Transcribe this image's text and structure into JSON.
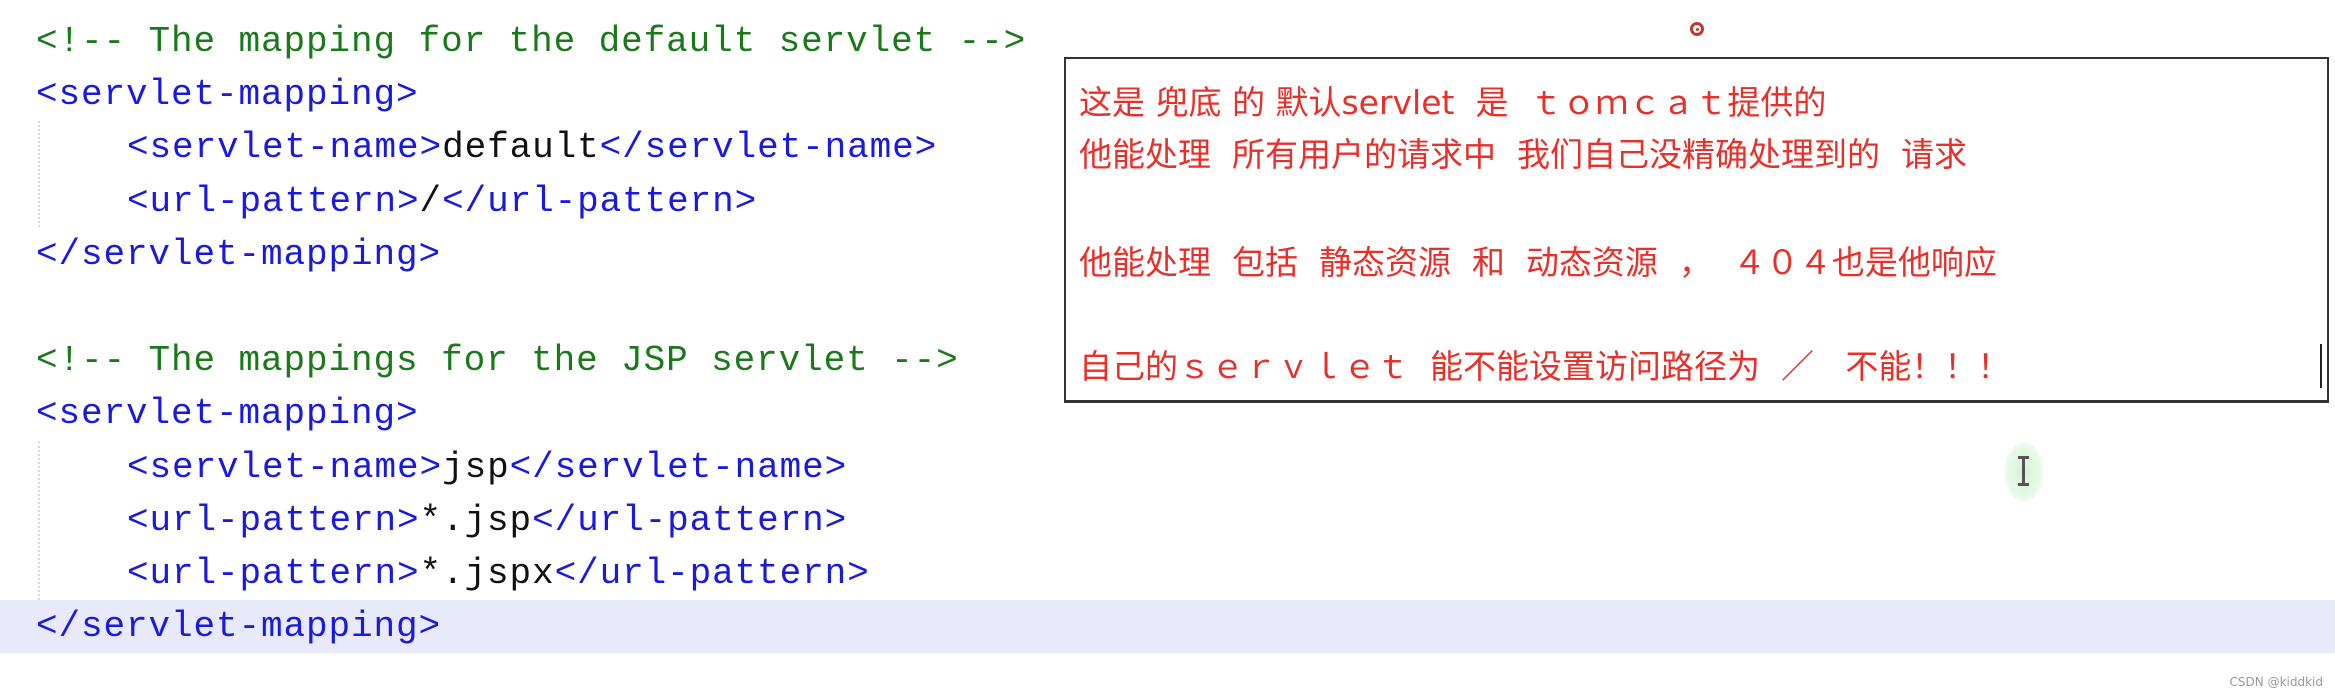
{
  "code": {
    "lines": [
      {
        "comment": "<!-- The mapping for the default servlet -->"
      },
      {
        "open": "<servlet-mapping>"
      },
      {
        "tag_open": "<servlet-name>",
        "value": "default",
        "tag_close": "</servlet-name>"
      },
      {
        "tag_open": "<url-pattern>",
        "value": "/",
        "tag_close": "</url-pattern>"
      },
      {
        "close": "</servlet-mapping>"
      },
      {},
      {
        "comment": "<!-- The mappings for the JSP servlet -->"
      },
      {
        "open": "<servlet-mapping>"
      },
      {
        "tag_open": "<servlet-name>",
        "value": "jsp",
        "tag_close": "</servlet-name>"
      },
      {
        "tag_open": "<url-pattern>",
        "value": "*.jsp",
        "tag_close": "</url-pattern>"
      },
      {
        "tag_open": "<url-pattern>",
        "value": "*.jspx",
        "tag_close": "</url-pattern>"
      },
      {
        "close": "</servlet-mapping>"
      }
    ]
  },
  "note": {
    "lines": [
      "这是 兜底 的 默认servlet  是  ｔｏｍｃａｔ提供的",
      "他能处理  所有用户的请求中  我们自己没精确处理到的  请求",
      "他能处理  包括  静态资源  和  动态资源  ，  ４０４也是他响应",
      "自己的ｓｅｒｖｌｅｔ  能不能设置访问路径为  ／   不能！！！"
    ],
    "text_color": "#e8302a"
  },
  "colors": {
    "comment": "#1a7a1a",
    "tag": "#1a1adc",
    "highlight_line": "#e8eafc"
  },
  "watermark": "CSDN @kiddkid"
}
